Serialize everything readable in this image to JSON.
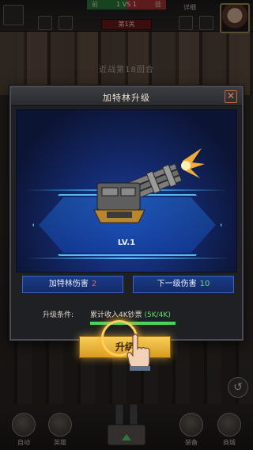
{
  "hud": {
    "vs_score": "1 VS 1",
    "left_tag": "前",
    "right_tag": "徒",
    "right_label": "详细",
    "stage": "第1关"
  },
  "round_text": "近战第18回合",
  "bottom_bar": {
    "buttons": [
      "自动",
      "英雄",
      "",
      "装备",
      "商城"
    ]
  },
  "modal": {
    "title": "加特林升级",
    "close_icon": "close-x-icon",
    "level": "LV.1",
    "stats": {
      "current_label": "加特林伤害",
      "current_value": "2",
      "next_label": "下一级伤害",
      "next_value": "10"
    },
    "condition": {
      "label": "升级条件:",
      "text": "累计收入4K钞票",
      "progress": "(5K/4K)",
      "progress_fraction": 1.0
    },
    "upgrade_button": "升级"
  },
  "colors": {
    "accent_gold": "#f0b83a",
    "stat_red": "#ff5a5a",
    "stat_green": "#5fe06a",
    "platform_blue": "#4fc0ff"
  }
}
